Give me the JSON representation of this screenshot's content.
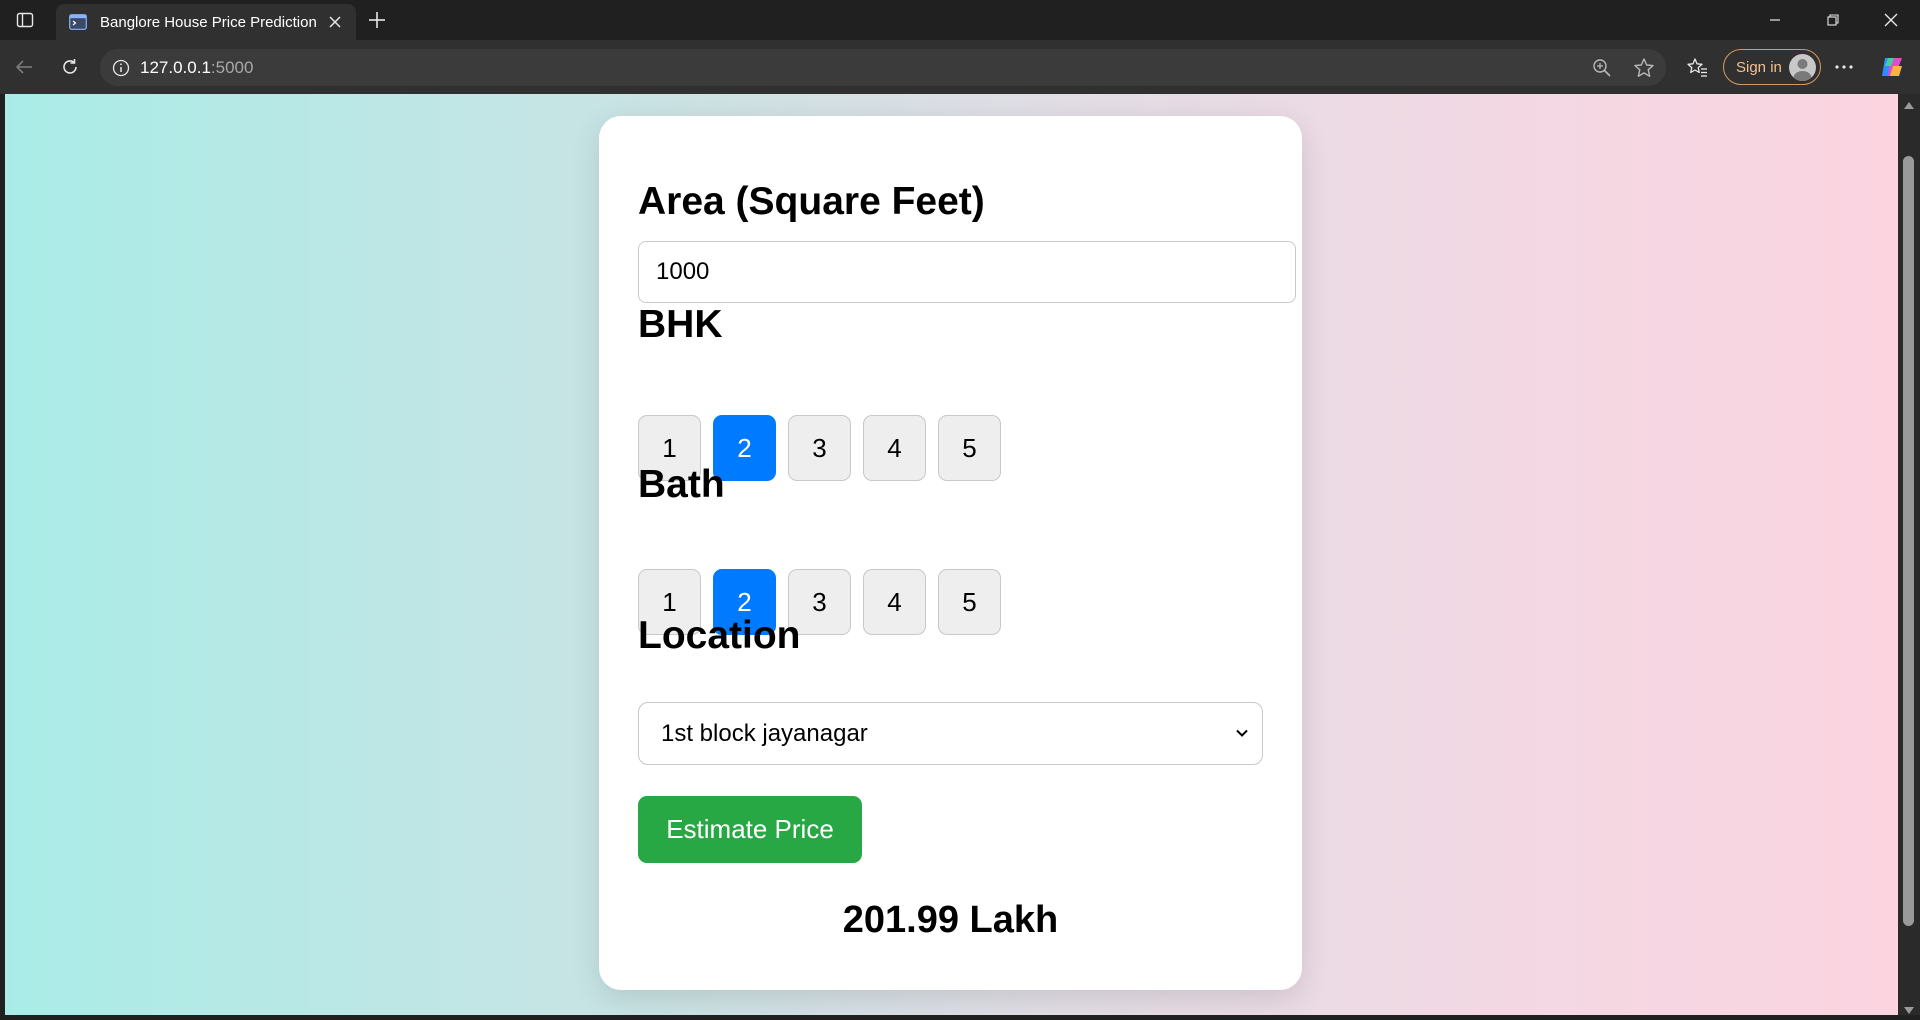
{
  "browser": {
    "tab": {
      "title": "Banglore House Price Prediction"
    },
    "address": {
      "host": "127.0.0.1",
      "port": ":5000"
    },
    "signin_label": "Sign in"
  },
  "form": {
    "area": {
      "label": "Area (Square Feet)",
      "value": "1000"
    },
    "bhk": {
      "label": "BHK",
      "options": [
        "1",
        "2",
        "3",
        "4",
        "5"
      ],
      "selected": "2"
    },
    "bath": {
      "label": "Bath",
      "options": [
        "1",
        "2",
        "3",
        "4",
        "5"
      ],
      "selected": "2"
    },
    "location": {
      "label": "Location",
      "selected": "1st block jayanagar"
    },
    "submit_label": "Estimate Price"
  },
  "result": {
    "text": "201.99 Lakh"
  },
  "colors": {
    "active_button": "#007bff",
    "submit_button": "#28a745",
    "gradient_left": "#a9ece7",
    "gradient_right": "#fbd4e0"
  },
  "icons": [
    "sidebar-toggle-icon",
    "terminal-favicon-icon",
    "close-icon",
    "plus-icon",
    "minimize-icon",
    "restore-icon",
    "back-arrow-icon",
    "reload-icon",
    "info-icon",
    "zoom-icon",
    "star-icon",
    "favorites-icon",
    "more-icon",
    "copilot-icon",
    "chevron-down-icon"
  ]
}
